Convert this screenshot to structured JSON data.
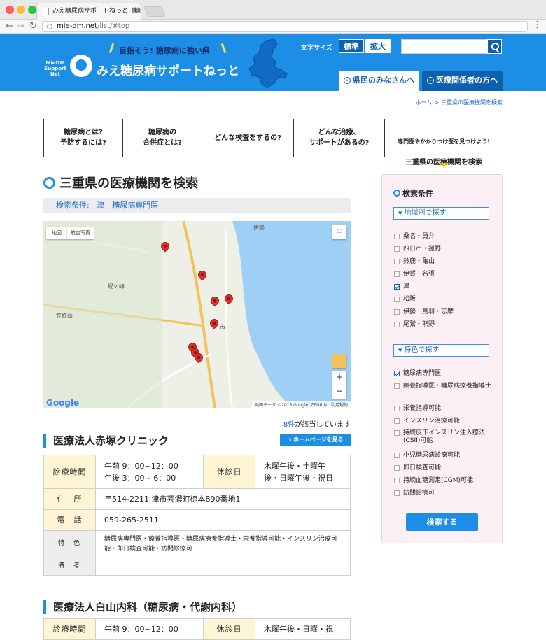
{
  "browser": {
    "tab_title": "みえ糖尿病サポートねっと《糖尿",
    "url_domain": "mie-dm.net",
    "url_path": "/list/#top"
  },
  "header": {
    "catch": "目指そう! 糖尿病に強い県",
    "logo_sub": "MieDM Support Net",
    "logo_title": "みえ糖尿病サポートねっと",
    "font_size_label": "文字サイズ",
    "font_standard": "標準",
    "font_large": "拡大",
    "search_value": "",
    "tab_residents": "県民のみなさんへ",
    "tab_medical": "医療関係者の方へ",
    "colors": {
      "brand": "#1d8ee5",
      "nav_dark": "#0d5fb0"
    }
  },
  "breadcrumb": {
    "home": "ホーム",
    "sep": ">",
    "current": "三重県の医療機関を検索"
  },
  "global_nav": [
    {
      "label": "糖尿病とは?\n予防するには?"
    },
    {
      "label": "糖尿病の\n合併症とは?"
    },
    {
      "label": "どんな検査をするの?"
    },
    {
      "label": "どんな治療、\nサポートがあるの?"
    },
    {
      "small": "専門医やかかりつけ医を見つけよう!",
      "label": "三重県の医療機関を検索"
    }
  ],
  "page_title": "三重県の医療機関を検索",
  "condition": {
    "label": "検索条件:",
    "value": "津　糖尿病専門医"
  },
  "map": {
    "type_map": "地図",
    "type_sat": "航空写真",
    "labels": [
      "経ケ峰",
      "笠取山",
      "伊勢",
      "市"
    ],
    "google": "Google",
    "copyright": "地図データ ©2018 Google, ZENRIN　利用規約"
  },
  "result": {
    "count": "8件",
    "suffix": "が該当しています"
  },
  "clinic1": {
    "name": "医療法人赤塚クリニック",
    "homepage_button": "ホームページを見る",
    "hours_label": "診療時間",
    "hours_line1": "午前 9：00~12：00",
    "hours_line2": "午後 3：00~ 6：00",
    "closed_label": "休診日",
    "closed_line1": "木曜午後・土曜午",
    "closed_line2": "後・日曜午後・祝日",
    "address_label": "住　所",
    "address": "〒514-2211 津市芸濃町椋本890番地1",
    "phone_label": "電　話",
    "phone": "059-265-2511",
    "features_label": "特　色",
    "features": "糖尿病専門医・療養指導医・糖尿病療養指導士・栄養指導可能・インスリン治療可能・即日検査可能・訪問診療可",
    "notes_label": "備　考",
    "notes": ""
  },
  "clinic2": {
    "name": "医療法人白山内科（糖尿病・代謝内科）",
    "hours_line1": "午前 9：00~12：00",
    "closed_line1": "木曜午後・日曜・祝"
  },
  "sidebar": {
    "title": "検索条件",
    "area_section": "地域別で探す",
    "areas": [
      {
        "label": "桑名・員弁",
        "checked": false
      },
      {
        "label": "四日市・菰野",
        "checked": false
      },
      {
        "label": "鈴鹿・亀山",
        "checked": false
      },
      {
        "label": "伊賀・名張",
        "checked": false
      },
      {
        "label": "津",
        "checked": true
      },
      {
        "label": "松阪",
        "checked": false
      },
      {
        "label": "伊勢・鳥羽・志摩",
        "checked": false
      },
      {
        "label": "尾鷲・熊野",
        "checked": false
      }
    ],
    "feature_section": "特色で探す",
    "features": [
      {
        "label": "糖尿病専門医",
        "checked": true
      },
      {
        "label": "療養指導医・糖尿病療養指導士",
        "checked": false
      },
      {
        "label": "栄養指導可能",
        "checked": false
      },
      {
        "label": "インスリン治療可能",
        "checked": false
      },
      {
        "label": "持続皮下インスリン注入療法(CSII)可能",
        "checked": false
      },
      {
        "label": "小児糖尿病診療可能",
        "checked": false
      },
      {
        "label": "即日検査可能",
        "checked": false
      },
      {
        "label": "持続血糖測定(CGM)可能",
        "checked": false
      },
      {
        "label": "訪問診療可",
        "checked": false
      }
    ],
    "search_button": "検索する"
  }
}
